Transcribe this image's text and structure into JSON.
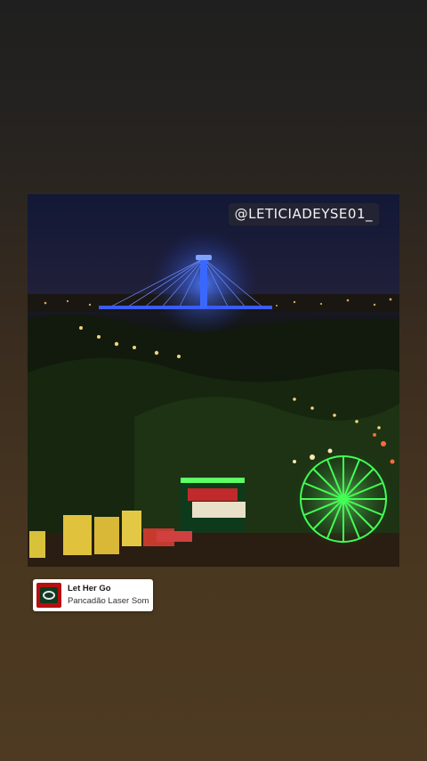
{
  "photo": {
    "caption": "@LETICIADEYSE01_"
  },
  "music_sticker": {
    "title": "Let Her Go",
    "artist": "Pancadão Laser Som",
    "art_icon": "album-cover-icon"
  },
  "colors": {
    "background_top": "#1f1f1f",
    "background_bottom": "#4e3a22",
    "tower_light": "#2f5bff",
    "ferris_wheel": "#3cff5a"
  }
}
